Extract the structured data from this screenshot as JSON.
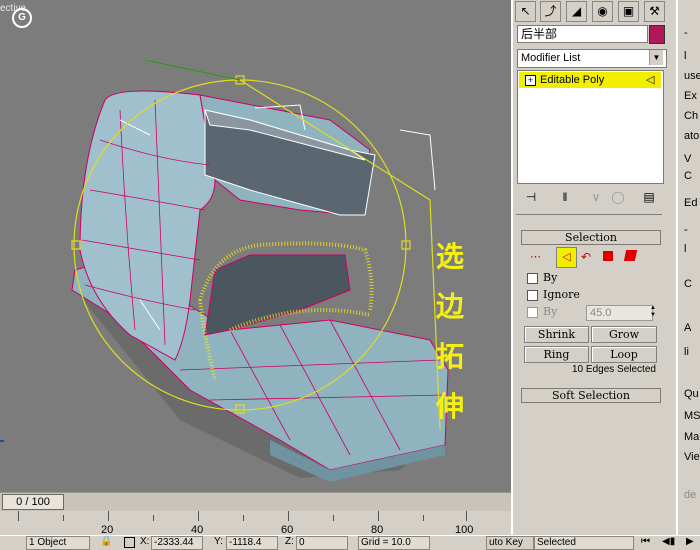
{
  "viewport": {
    "label": "ective",
    "nav_glyph": "G",
    "annotation": "选边拓伸"
  },
  "timeline": {
    "position": "0 / 100",
    "ticks": [
      "20",
      "40",
      "60",
      "80",
      "100"
    ]
  },
  "status": {
    "selection": "1 Object",
    "x_label": "X:",
    "x_value": "-2333.44",
    "y_label": "Y:",
    "y_value": "-1118.4",
    "z_label": "Z:",
    "z_value": "0",
    "grid": "Grid = 10.0",
    "auto_key": "uto Key",
    "key_mode": "Selected"
  },
  "command_panel": {
    "tab_icons": [
      "cursor-icon",
      "bend-icon",
      "hierarchy-icon",
      "motion-icon",
      "display-icon",
      "utilities-icon"
    ],
    "object_name": "后半部",
    "object_color": "#b0185a",
    "modifier_list": "Modifier List",
    "stack_item": "Editable Poly",
    "selection_rollout": {
      "minus": "-",
      "title": "Selection",
      "by_vertex": "By",
      "ignore": "Ignore",
      "by_angle": "By",
      "angle": "45.0",
      "shrink": "Shrink",
      "grow": "Grow",
      "ring": "Ring",
      "loop": "Loop",
      "status": "10 Edges Selected"
    },
    "soft_selection": {
      "plus": "+",
      "title": "Soft Selection"
    }
  },
  "right_strip": {
    "items": [
      "-",
      "l",
      "use",
      "Ex",
      "Ch",
      "ato",
      "V",
      "C",
      "Ed",
      "-",
      "l",
      "C",
      "A",
      "li",
      "Qu",
      "MS",
      "Ma",
      "Vie",
      "de"
    ]
  },
  "colors": {
    "viewport_bg": "#7c7c7c",
    "edges_selected": "#cc0066",
    "annotation": "#f6f010",
    "stack_highlight": "#f2ee00"
  }
}
